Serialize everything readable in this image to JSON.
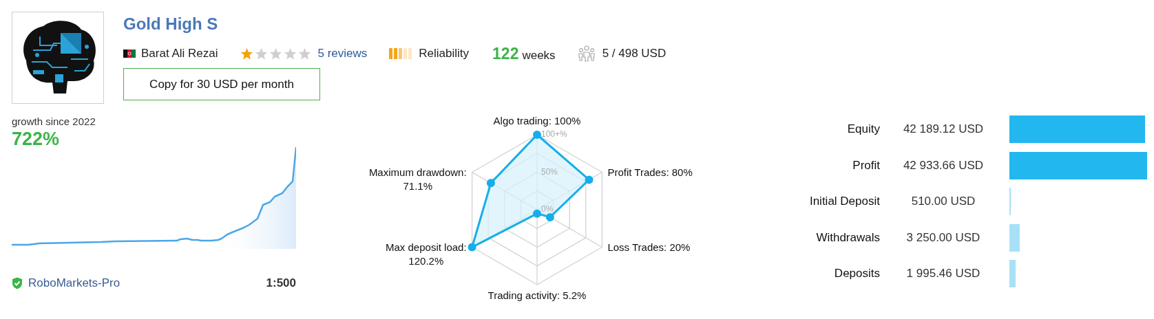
{
  "title": "Gold High S",
  "author": {
    "name": "Barat Ali Rezai"
  },
  "rating": {
    "stars": 1,
    "reviews": "5 reviews"
  },
  "reliability": {
    "label": "Reliability"
  },
  "weeks": {
    "value": "122",
    "unit": "weeks"
  },
  "subscribers": "5 / 498 USD",
  "copy_button": "Copy for 30 USD per month",
  "growth": {
    "caption": "growth since 2022",
    "value": "722%",
    "broker": "RoboMarkets-Pro",
    "leverage": "1:500"
  },
  "radar": {
    "ring_labels": [
      "100+%",
      "50%",
      "0%"
    ],
    "axes": [
      {
        "label": "Algo trading:",
        "value": "100%"
      },
      {
        "label": "Maximum drawdown:",
        "value": "71.1%"
      },
      {
        "label": "Profit Trades:",
        "value": "80%"
      },
      {
        "label": "Max deposit load:",
        "value": "120.2%"
      },
      {
        "label": "Loss Trades:",
        "value": "20%"
      },
      {
        "label": "Trading activity:",
        "value": "5.2%"
      }
    ]
  },
  "balance": [
    {
      "label": "Equity",
      "value": "42 189.12 USD",
      "color": "#22b7ef"
    },
    {
      "label": "Profit",
      "value": "42 933.66 USD",
      "color": "#22b7ef"
    },
    {
      "label": "Initial Deposit",
      "value": "510.00 USD",
      "color": "#a8e0f7"
    },
    {
      "label": "Withdrawals",
      "value": "3 250.00 USD",
      "color": "#a8e0f7"
    },
    {
      "label": "Deposits",
      "value": "1 995.46 USD",
      "color": "#a8e0f7"
    }
  ]
}
